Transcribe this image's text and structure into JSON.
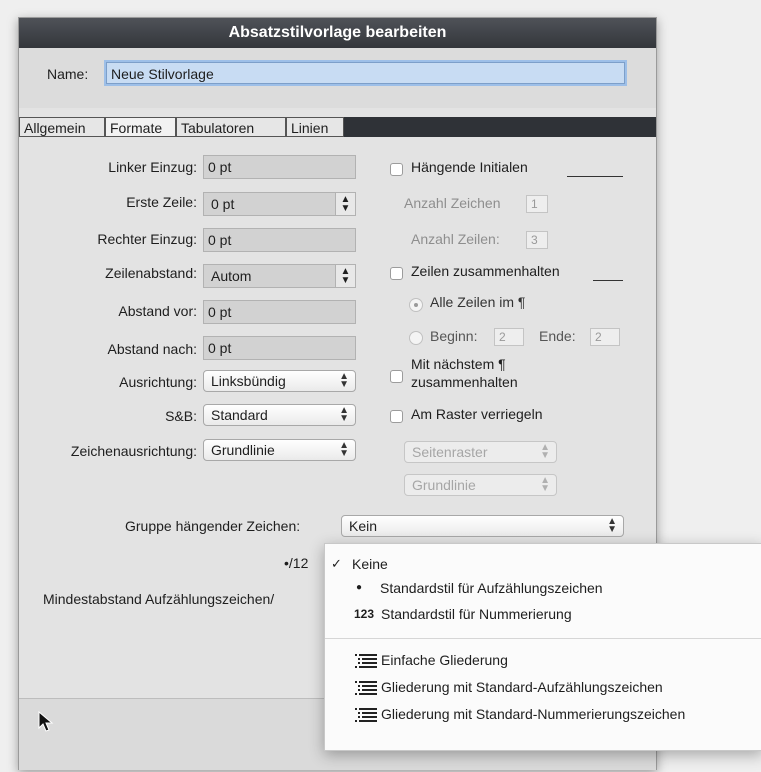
{
  "dialog": {
    "title": "Absatzstilvorlage bearbeiten",
    "name_label": "Name:",
    "name_value": "Neue Stilvorlage"
  },
  "tabs": [
    {
      "label": "Allgemein"
    },
    {
      "label": "Formate",
      "active": true
    },
    {
      "label": "Tabulatoren"
    },
    {
      "label": "Linien"
    }
  ],
  "left": {
    "linker_einzug_label": "Linker Einzug:",
    "linker_einzug_value": "0 pt",
    "erste_zeile_label": "Erste Zeile:",
    "erste_zeile_value": "0 pt",
    "rechter_einzug_label": "Rechter Einzug:",
    "rechter_einzug_value": "0 pt",
    "zeilenabstand_label": "Zeilenabstand:",
    "zeilenabstand_value": "Autom",
    "abstand_vor_label": "Abstand vor:",
    "abstand_vor_value": "0 pt",
    "abstand_nach_label": "Abstand nach:",
    "abstand_nach_value": "0 pt",
    "ausrichtung_label": "Ausrichtung:",
    "ausrichtung_value": "Linksbündig",
    "sb_label": "S&B:",
    "sb_value": "Standard",
    "zeichenausrichtung_label": "Zeichenausrichtung:",
    "zeichenausrichtung_value": "Grundlinie"
  },
  "right": {
    "haengende_initialen": "Hängende Initialen",
    "anzahl_zeichen_label": "Anzahl Zeichen",
    "anzahl_zeichen_value": "1",
    "anzahl_zeilen_label": "Anzahl Zeilen:",
    "anzahl_zeilen_value": "3",
    "zeilen_zusammenhalten": "Zeilen zusammenhalten",
    "alle_zeilen": "Alle Zeilen im ¶",
    "beginn_label": "Beginn:",
    "beginn_value": "2",
    "ende_label": "Ende:",
    "ende_value": "2",
    "mit_naechstem_line1": "Mit nächstem ¶",
    "mit_naechstem_line2": "zusammenhalten",
    "am_raster": "Am Raster verriegeln",
    "seitenraster": "Seitenraster",
    "grundlinie": "Grundlinie"
  },
  "lower": {
    "gruppe_label": "Gruppe hängender Zeichen:",
    "gruppe_value": "Kein",
    "bullet_label": "•/12",
    "mindestabstand_label": "Mindestabstand Aufzählungszeichen/"
  },
  "popup_menu": {
    "items": [
      {
        "prefix": "✓",
        "label": "Keine"
      },
      {
        "prefix": "●",
        "label": "Standardstil für Aufzählungszeichen"
      },
      {
        "prefix": "123",
        "label": "Standardstil für Nummerierung"
      },
      {
        "icon": "outline-list-icon",
        "label": "Einfache Gliederung"
      },
      {
        "icon": "outline-list-icon",
        "label": "Gliederung mit Standard-Aufzählungszeichen"
      },
      {
        "icon": "outline-list-icon",
        "label": "Gliederung mit Standard-Nummerierungszeichen"
      }
    ]
  }
}
